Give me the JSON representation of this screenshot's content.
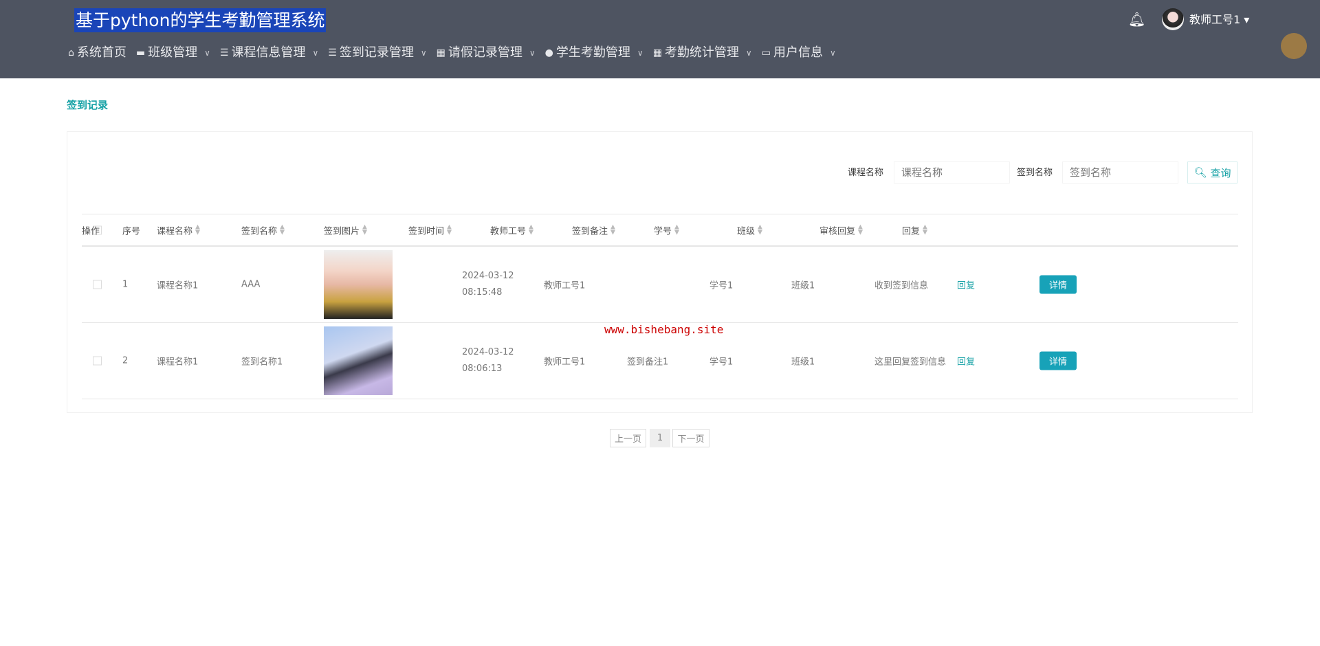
{
  "header": {
    "title": "基于python的学生考勤管理系统",
    "username": "教师工号1",
    "nav": [
      {
        "label": "系统首页",
        "icon": "home-icon",
        "dropdown": false
      },
      {
        "label": "班级管理",
        "icon": "briefcase-icon",
        "dropdown": true
      },
      {
        "label": "课程信息管理",
        "icon": "list-icon",
        "dropdown": true
      },
      {
        "label": "签到记录管理",
        "icon": "list-icon",
        "dropdown": true
      },
      {
        "label": "请假记录管理",
        "icon": "grid-icon",
        "dropdown": true
      },
      {
        "label": "学生考勤管理",
        "icon": "pin-icon",
        "dropdown": true
      },
      {
        "label": "考勤统计管理",
        "icon": "grid-icon",
        "dropdown": true
      },
      {
        "label": "用户信息",
        "icon": "card-icon",
        "dropdown": true
      }
    ]
  },
  "breadcrumb": "签到记录",
  "search": {
    "course_label": "课程名称",
    "course_placeholder": "课程名称",
    "sign_label": "签到名称",
    "sign_placeholder": "签到名称",
    "button": "查询"
  },
  "table": {
    "columns": [
      "序号",
      "课程名称",
      "签到名称",
      "签到图片",
      "签到时间",
      "教师工号",
      "签到备注",
      "学号",
      "班级",
      "审核回复",
      "回复",
      "操作"
    ],
    "rows": [
      {
        "no": "1",
        "course": "课程名称1",
        "sign": "AAA",
        "time": "2024-03-12 08:15:48",
        "teacher": "教师工号1",
        "remark": "",
        "student": "学号1",
        "class": "班级1",
        "review": "收到签到信息",
        "reply": "回复",
        "action": "详情"
      },
      {
        "no": "2",
        "course": "课程名称1",
        "sign": "签到名称1",
        "time": "2024-03-12 08:06:13",
        "teacher": "教师工号1",
        "remark": "签到备注1",
        "student": "学号1",
        "class": "班级1",
        "review": "这里回复签到信息",
        "reply": "回复",
        "action": "详情"
      }
    ]
  },
  "watermark": "www.bishebang.site",
  "pagination": {
    "prev": "上一页",
    "current": "1",
    "next": "下一页"
  }
}
